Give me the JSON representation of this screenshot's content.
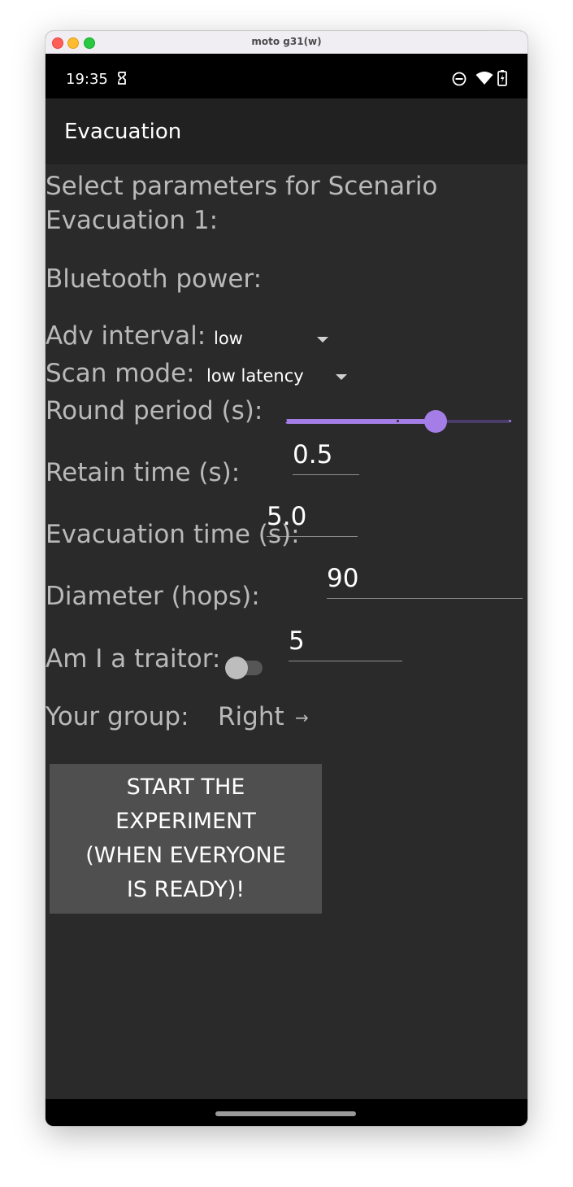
{
  "window": {
    "title": "moto g31(w)"
  },
  "status_bar": {
    "time": "19:35",
    "icons": [
      "notification-icon",
      "do-not-disturb-icon",
      "wifi-icon",
      "battery-icon"
    ]
  },
  "app_bar": {
    "title": "Evacuation"
  },
  "form": {
    "heading": "Select parameters for Scenario Evacuation 1:",
    "bluetooth_power": {
      "label": "Bluetooth power:",
      "value_fraction": 0.67,
      "steps": 3
    },
    "adv_interval": {
      "label": "Adv interval:",
      "selected": "low"
    },
    "scan_mode": {
      "label": "Scan mode:",
      "selected": "low latency"
    },
    "round_period": {
      "label": "Round period (s):",
      "value": "0.5"
    },
    "retain_time": {
      "label": "Retain time (s):",
      "value": "5.0"
    },
    "evacuation_time": {
      "label": "Evacuation time (s):",
      "value": "90"
    },
    "diameter": {
      "label": "Diameter (hops):",
      "value": "5"
    },
    "traitor": {
      "label": "Am I a traitor:",
      "checked": false
    },
    "group": {
      "label": "Your group:",
      "value": "Right",
      "arrow": "→"
    },
    "start_button": {
      "lines": [
        "START THE",
        "EXPERIMENT",
        "(WHEN EVERYONE",
        "IS READY)!"
      ]
    }
  },
  "colors": {
    "accent": "#a47ee6",
    "background": "#2a2a2a",
    "app_bar": "#212121",
    "button": "#4f4f4f",
    "label": "#b9b9b9"
  }
}
